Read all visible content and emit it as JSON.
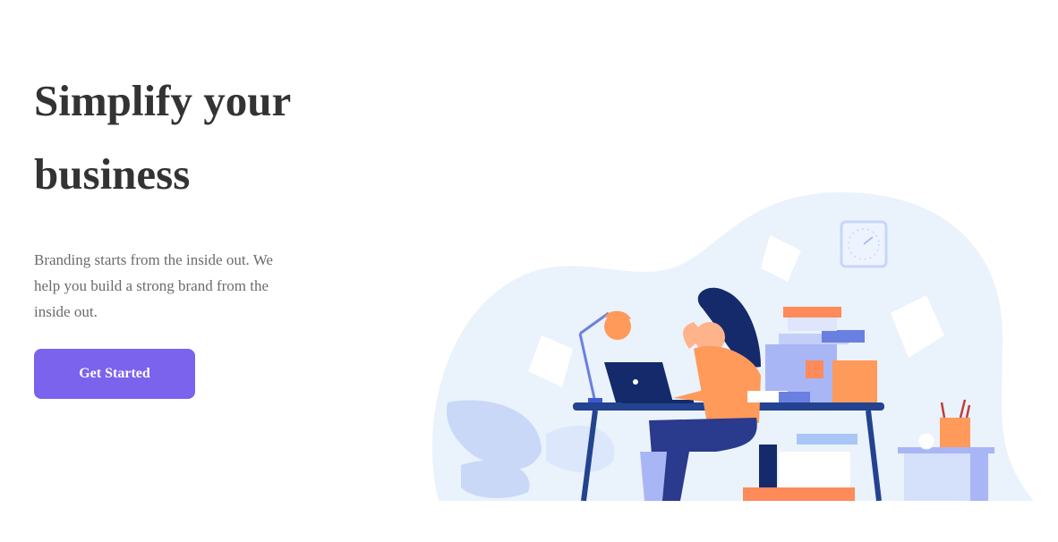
{
  "hero": {
    "headline": "Simplify your business",
    "subcopy": "Branding starts from the inside out. We help you build a strong brand from the inside out.",
    "cta_label": "Get Started"
  },
  "colors": {
    "accent": "#7b63ee",
    "headline": "#333333",
    "body_text": "#6b6b6b",
    "blob": "#eaf2fb",
    "orange": "#ff9a5a",
    "navy": "#1f3f93",
    "periwinkle": "#a9b6f5"
  },
  "illustration": {
    "subject": "woman working at desk with laptop",
    "icons": [
      "clock-icon",
      "lamp-icon",
      "laptop-icon",
      "plant-icon",
      "pencil-cup-icon",
      "file-stack-icon"
    ]
  }
}
